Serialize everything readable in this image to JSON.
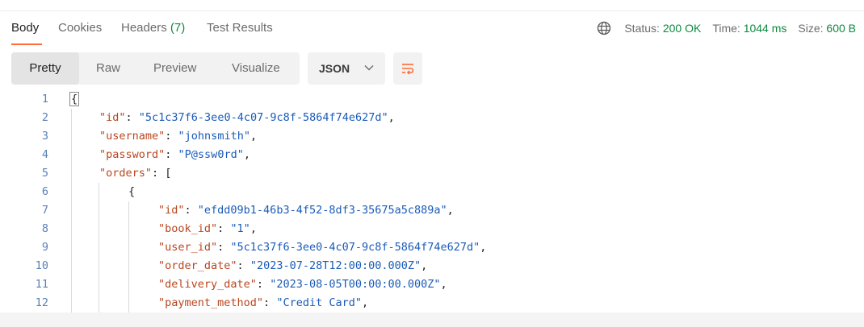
{
  "tabs": {
    "body": "Body",
    "cookies": "Cookies",
    "headers_label": "Headers",
    "headers_count": "(7)",
    "test_results": "Test Results"
  },
  "status": {
    "status_label": "Status:",
    "status_value": "200 OK",
    "time_label": "Time:",
    "time_value": "1044 ms",
    "size_label": "Size:",
    "size_value": "600 B"
  },
  "view_modes": {
    "pretty": "Pretty",
    "raw": "Raw",
    "preview": "Preview",
    "visualize": "Visualize"
  },
  "format": {
    "selected": "JSON"
  },
  "icons": {
    "globe": "globe-icon",
    "chevron": "chevron-down-icon",
    "wrap": "wrap-lines-icon"
  },
  "colors": {
    "accent": "#ff6c37",
    "success": "#0c8a3e",
    "json_key": "#b9461e",
    "json_string": "#1a5bb8",
    "line_number": "#5a7fb5"
  },
  "code_lines": [
    {
      "n": "1",
      "parts": [
        {
          "t": "{",
          "c": "pun"
        }
      ]
    },
    {
      "n": "2",
      "parts": [
        {
          "t": "\"id\"",
          "c": "key"
        },
        {
          "t": ": ",
          "c": "pun"
        },
        {
          "t": "\"5c1c37f6-3ee0-4c07-9c8f-5864f74e627d\"",
          "c": "str"
        },
        {
          "t": ",",
          "c": "pun"
        }
      ]
    },
    {
      "n": "3",
      "parts": [
        {
          "t": "\"username\"",
          "c": "key"
        },
        {
          "t": ": ",
          "c": "pun"
        },
        {
          "t": "\"johnsmith\"",
          "c": "str"
        },
        {
          "t": ",",
          "c": "pun"
        }
      ]
    },
    {
      "n": "4",
      "parts": [
        {
          "t": "\"password\"",
          "c": "key"
        },
        {
          "t": ": ",
          "c": "pun"
        },
        {
          "t": "\"P@ssw0rd\"",
          "c": "str"
        },
        {
          "t": ",",
          "c": "pun"
        }
      ]
    },
    {
      "n": "5",
      "parts": [
        {
          "t": "\"orders\"",
          "c": "key"
        },
        {
          "t": ": [",
          "c": "pun"
        }
      ]
    },
    {
      "n": "6",
      "parts": [
        {
          "t": "{",
          "c": "pun"
        }
      ]
    },
    {
      "n": "7",
      "parts": [
        {
          "t": "\"id\"",
          "c": "key"
        },
        {
          "t": ": ",
          "c": "pun"
        },
        {
          "t": "\"efdd09b1-46b3-4f52-8df3-35675a5c889a\"",
          "c": "str"
        },
        {
          "t": ",",
          "c": "pun"
        }
      ]
    },
    {
      "n": "8",
      "parts": [
        {
          "t": "\"book_id\"",
          "c": "key"
        },
        {
          "t": ": ",
          "c": "pun"
        },
        {
          "t": "\"1\"",
          "c": "str"
        },
        {
          "t": ",",
          "c": "pun"
        }
      ]
    },
    {
      "n": "9",
      "parts": [
        {
          "t": "\"user_id\"",
          "c": "key"
        },
        {
          "t": ": ",
          "c": "pun"
        },
        {
          "t": "\"5c1c37f6-3ee0-4c07-9c8f-5864f74e627d\"",
          "c": "str"
        },
        {
          "t": ",",
          "c": "pun"
        }
      ]
    },
    {
      "n": "10",
      "parts": [
        {
          "t": "\"order_date\"",
          "c": "key"
        },
        {
          "t": ": ",
          "c": "pun"
        },
        {
          "t": "\"2023-07-28T12:00:00.000Z\"",
          "c": "str"
        },
        {
          "t": ",",
          "c": "pun"
        }
      ]
    },
    {
      "n": "11",
      "parts": [
        {
          "t": "\"delivery_date\"",
          "c": "key"
        },
        {
          "t": ": ",
          "c": "pun"
        },
        {
          "t": "\"2023-08-05T00:00:00.000Z\"",
          "c": "str"
        },
        {
          "t": ",",
          "c": "pun"
        }
      ]
    },
    {
      "n": "12",
      "parts": [
        {
          "t": "\"payment_method\"",
          "c": "key"
        },
        {
          "t": ": ",
          "c": "pun"
        },
        {
          "t": "\"Credit Card\"",
          "c": "str"
        },
        {
          "t": ",",
          "c": "pun"
        }
      ]
    }
  ]
}
